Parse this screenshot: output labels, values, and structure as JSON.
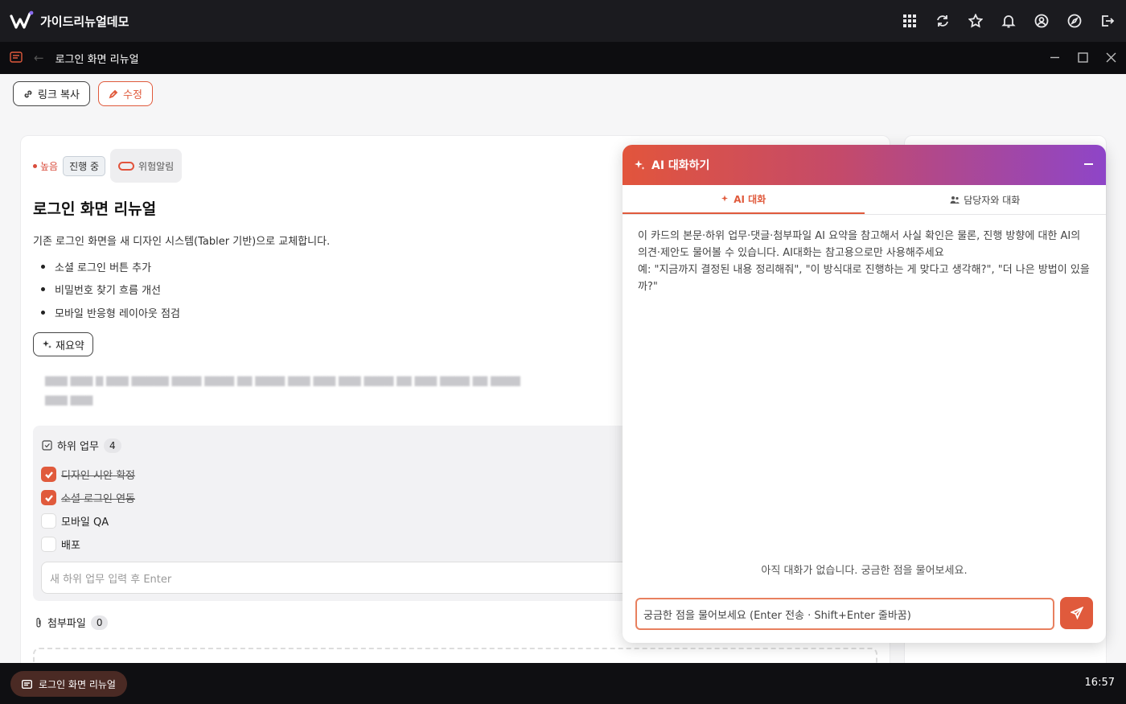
{
  "app": {
    "title": "가이드리뉴얼데모"
  },
  "window": {
    "title": "로그인 화면 리뉴얼"
  },
  "toolbar": {
    "copy_link": "링크 복사",
    "edit": "수정"
  },
  "card": {
    "priority": "높음",
    "status": "진행 중",
    "risk_label": "위험알림",
    "title": "로그인 화면 리뉴얼",
    "description": "기존 로그인 화면을 새 디자인 시스템(Tabler 기반)으로 교체합니다.",
    "bullets": [
      "소셜 로그인 버튼 추가",
      "비밀번호 찾기 흐름 개선",
      "모바일 반응형 레이아웃 점검"
    ],
    "resummary": "재요약"
  },
  "subtasks": {
    "title": "하위 업무",
    "count": "4",
    "items": [
      {
        "label": "디자인 시안 확정",
        "done": true
      },
      {
        "label": "소셜 로그인 연동",
        "done": true
      },
      {
        "label": "모바일 QA",
        "done": false
      },
      {
        "label": "배포",
        "done": false
      }
    ],
    "input_placeholder": "새 하위 업무 입력 후 Enter"
  },
  "attachments": {
    "title": "첨부파일",
    "count": "0"
  },
  "ai_panel": {
    "title": "AI 대화하기",
    "tabs": [
      "AI 대화",
      "담당자와 대화"
    ],
    "intro_1": "이 카드의 본문·하위 업무·댓글·첨부파일 AI 요약을 참고해서 사실 확인은 물론, 진행 방향에 대한 AI의 의견·제안도 물어볼 수 있습니다. AI대화는 참고용으로만 사용해주세요",
    "intro_2": "예: \"지금까지 결정된 내용 정리해줘\", \"이 방식대로 진행하는 게 맞다고 생각해?\", \"더 나은 방법이 있을까?\"",
    "empty": "아직 대화가 없습니다. 궁금한 점을 물어보세요.",
    "input_placeholder": "궁금한 점을 물어보세요 (Enter 전송 · Shift+Enter 줄바꿈)"
  },
  "taskbar": {
    "chip": "로그인 화면 리뉴얼",
    "clock": "16:57"
  },
  "colors": {
    "accent": "#e05a3c",
    "gradient_end": "#8e45c8",
    "topbar": "#1b1b1f"
  }
}
